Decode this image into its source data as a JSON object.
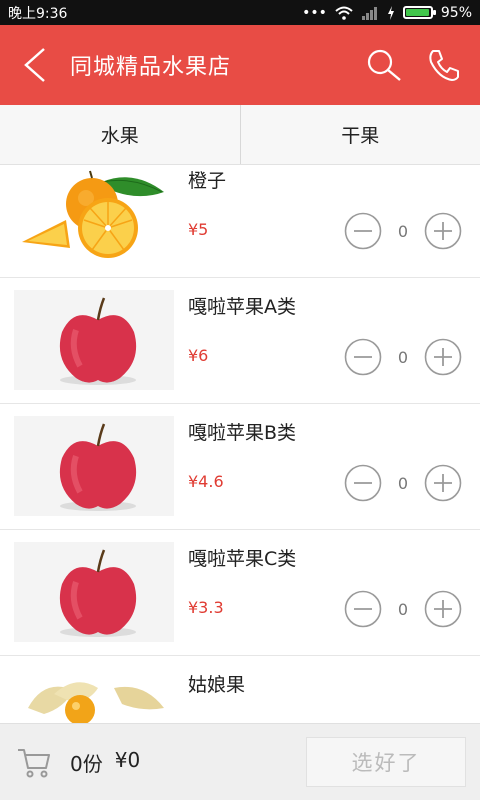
{
  "status": {
    "time": "晚上9:36",
    "battery": "95%",
    "battery_level": 0.95
  },
  "header": {
    "title": "同城精品水果店"
  },
  "tabs": [
    {
      "label": "水果"
    },
    {
      "label": "干果"
    }
  ],
  "items": [
    {
      "name": "橙子",
      "price": "¥5",
      "qty": "0",
      "image": "orange"
    },
    {
      "name": "嘎啦苹果A类",
      "price": "¥6",
      "qty": "0",
      "image": "apple"
    },
    {
      "name": "嘎啦苹果B类",
      "price": "¥4.6",
      "qty": "0",
      "image": "apple"
    },
    {
      "name": "嘎啦苹果C类",
      "price": "¥3.3",
      "qty": "0",
      "image": "apple"
    },
    {
      "name": "姑娘果",
      "price": "",
      "qty": "",
      "image": "physalis"
    }
  ],
  "cart": {
    "count": "0份",
    "total": "¥0",
    "done_label": "选好了"
  },
  "colors": {
    "header_bg": "#e84c45",
    "price": "#e03c33"
  },
  "icons": {
    "back": "back-arrow-icon",
    "search": "search-icon",
    "phone": "phone-icon",
    "cart": "cart-icon",
    "minus": "minus-circle-icon",
    "plus": "plus-circle-icon",
    "wifi": "wifi-icon",
    "signal": "signal-icon",
    "battery": "battery-icon"
  }
}
